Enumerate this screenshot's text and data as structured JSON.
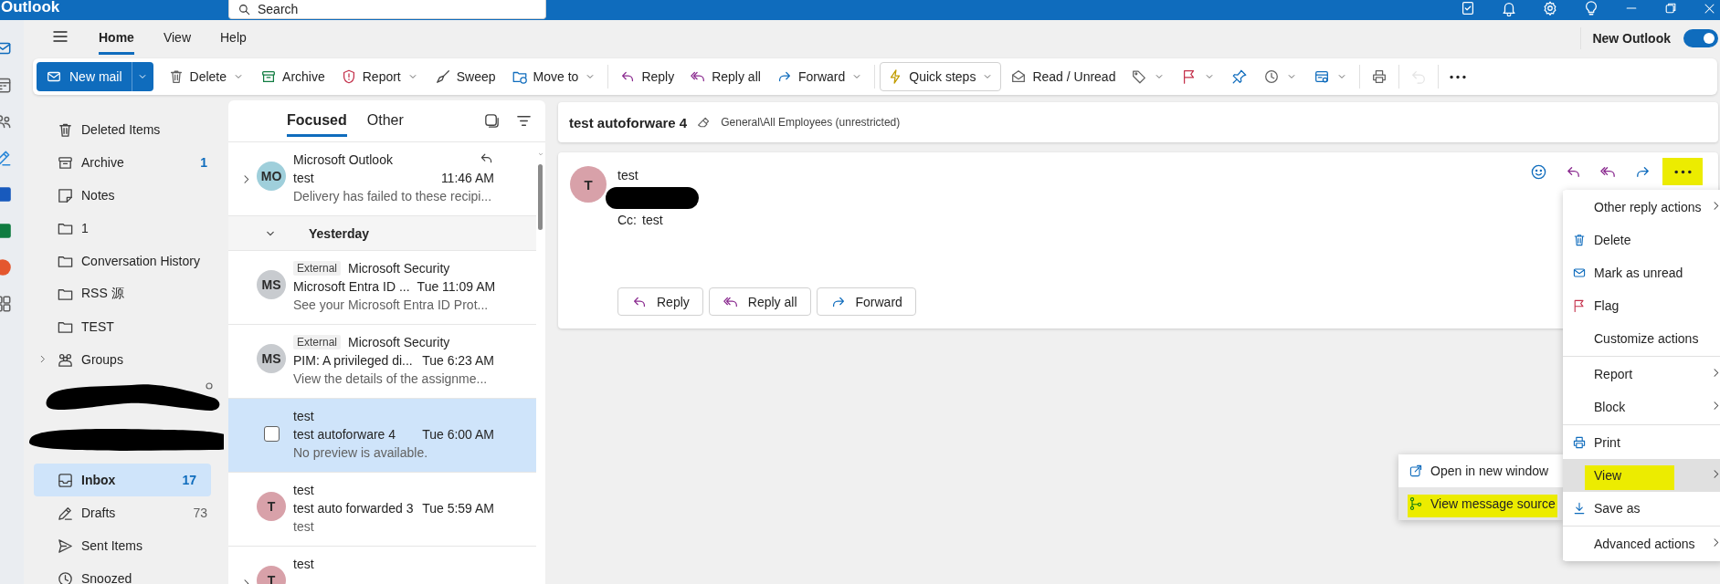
{
  "window": {
    "title": "Outlook"
  },
  "search": {
    "placeholder": "Search"
  },
  "tabs": [
    {
      "label": "Home",
      "selected": true
    },
    {
      "label": "View",
      "selected": false
    },
    {
      "label": "Help",
      "selected": false
    }
  ],
  "new_outlook": {
    "label": "New Outlook",
    "on": true
  },
  "ribbon": [
    {
      "kind": "primary",
      "label": "New mail",
      "has_menu": true,
      "disabled": false
    },
    {
      "kind": "button",
      "label": "Delete",
      "has_menu": true,
      "disabled": false
    },
    {
      "kind": "button",
      "label": "Archive",
      "has_menu": false,
      "disabled": false
    },
    {
      "kind": "button",
      "label": "Report",
      "has_menu": true,
      "disabled": false
    },
    {
      "kind": "button",
      "label": "Sweep",
      "has_menu": false,
      "disabled": false
    },
    {
      "kind": "button",
      "label": "Move to",
      "has_menu": true,
      "disabled": false
    },
    {
      "kind": "separator"
    },
    {
      "kind": "button",
      "label": "Reply",
      "has_menu": false,
      "disabled": false
    },
    {
      "kind": "button",
      "label": "Reply all",
      "has_menu": false,
      "disabled": false
    },
    {
      "kind": "button",
      "label": "Forward",
      "has_menu": true,
      "disabled": false
    },
    {
      "kind": "separator"
    },
    {
      "kind": "outlined",
      "label": "Quick steps",
      "has_menu": true,
      "disabled": false
    },
    {
      "kind": "button",
      "label": "Read / Unread",
      "has_menu": false,
      "disabled": false
    },
    {
      "kind": "icon",
      "has_menu": true,
      "disabled": false
    },
    {
      "kind": "icon",
      "has_menu": true,
      "disabled": false
    },
    {
      "kind": "icon",
      "has_menu": false,
      "disabled": false
    },
    {
      "kind": "icon",
      "has_menu": true,
      "disabled": false
    },
    {
      "kind": "icon",
      "has_menu": true,
      "disabled": false
    },
    {
      "kind": "separator"
    },
    {
      "kind": "icon",
      "has_menu": false,
      "disabled": false
    },
    {
      "kind": "separator"
    },
    {
      "kind": "icon",
      "has_menu": false,
      "disabled": true
    },
    {
      "kind": "separator"
    },
    {
      "kind": "icon",
      "has_menu": false,
      "disabled": false
    }
  ],
  "folders": [
    {
      "kind": "folder",
      "label": "Deleted Items",
      "selected": false
    },
    {
      "kind": "folder",
      "label": "Archive",
      "count": "1",
      "count_unread": true,
      "selected": false
    },
    {
      "kind": "folder",
      "label": "Notes",
      "selected": false
    },
    {
      "kind": "folder",
      "label": "1",
      "selected": false
    },
    {
      "kind": "folder",
      "label": "Conversation History",
      "selected": false
    },
    {
      "kind": "folder",
      "label": "RSS 源",
      "selected": false
    },
    {
      "kind": "folder",
      "label": "TEST",
      "selected": false
    },
    {
      "kind": "folder",
      "label": "Groups",
      "expanded": false,
      "selected": false
    },
    {
      "kind": "redacted"
    },
    {
      "kind": "folder",
      "label": "Inbox",
      "count": "17",
      "count_unread": true,
      "selected": true
    },
    {
      "kind": "folder",
      "label": "Drafts",
      "count": "73",
      "count_unread": false,
      "selected": false
    },
    {
      "kind": "folder",
      "label": "Sent Items",
      "selected": false
    },
    {
      "kind": "folder",
      "label": "Snoozed",
      "selected": false
    }
  ],
  "message_list": {
    "tabs": [
      {
        "label": "Focused",
        "selected": true
      },
      {
        "label": "Other",
        "selected": false
      }
    ],
    "items": [
      {
        "kind": "message",
        "sender": "Microsoft Outlook",
        "subject": "test",
        "time": "11:46 AM",
        "preview": "Delivery has failed to these recipi...",
        "initials": "MO",
        "color": "#9fcfdb",
        "thread": true,
        "status_icon": true,
        "selected": false
      },
      {
        "kind": "group",
        "label": "Yesterday",
        "expanded": true
      },
      {
        "kind": "message",
        "tag": "External",
        "sender": "Microsoft Security",
        "subject": "Microsoft Entra ID ...",
        "time": "Tue 11:09 AM",
        "preview": "See your Microsoft Entra ID Prot...",
        "initials": "MS",
        "color": "#c8cbcf",
        "thread": false,
        "status_icon": false,
        "selected": false
      },
      {
        "kind": "message",
        "tag": "External",
        "sender": "Microsoft Security",
        "subject": "PIM: A privileged di...",
        "time": "Tue 6:23 AM",
        "preview": "View the details of the assignme...",
        "initials": "MS",
        "color": "#c8cbcf",
        "thread": false,
        "status_icon": false,
        "selected": false
      },
      {
        "kind": "message",
        "sender": "test",
        "subject": "test autoforware 4",
        "time": "Tue 6:00 AM",
        "preview": "No preview is available.",
        "thread": false,
        "status_icon": false,
        "selected": true,
        "checked": false
      },
      {
        "kind": "message",
        "sender": "test",
        "subject": "test auto forwarded 3",
        "time": "Tue 5:59 AM",
        "preview": "test",
        "initials": "T",
        "color": "#d8a1a9",
        "thread": false,
        "status_icon": false,
        "selected": false
      },
      {
        "kind": "message",
        "sender": "test",
        "initials": "T",
        "color": "#d8a1a9",
        "thread": true,
        "status_icon": false,
        "selected": false
      }
    ]
  },
  "reading_pane": {
    "subject": "test autoforware 4",
    "label": "General\\All Employees (unrestricted)",
    "message": {
      "sender": "test",
      "initials": "T",
      "color": "#d8a1a9",
      "recipient_redacted": true,
      "cc_label": "Cc:",
      "cc": "test",
      "actions": [
        {
          "highlighted": false
        },
        {
          "highlighted": false
        },
        {
          "highlighted": false
        },
        {
          "highlighted": false
        },
        {
          "highlighted": true
        }
      ],
      "buttons": [
        {
          "label": "Reply"
        },
        {
          "label": "Reply all"
        },
        {
          "label": "Forward"
        }
      ]
    }
  },
  "context_menu": {
    "groups": [
      [
        {
          "label": "Other reply actions",
          "submenu": true,
          "selected": false,
          "highlighted": false
        },
        {
          "label": "Delete",
          "submenu": false,
          "selected": false,
          "highlighted": false
        },
        {
          "label": "Mark as unread",
          "submenu": false,
          "selected": false,
          "highlighted": false
        },
        {
          "label": "Flag",
          "submenu": false,
          "selected": false,
          "highlighted": false
        },
        {
          "label": "Customize actions",
          "submenu": false,
          "selected": false,
          "highlighted": false
        }
      ],
      [
        {
          "label": "Report",
          "submenu": true,
          "selected": false,
          "highlighted": false
        },
        {
          "label": "Block",
          "submenu": true,
          "selected": false,
          "highlighted": false
        }
      ],
      [
        {
          "label": "Print",
          "submenu": false,
          "selected": false,
          "highlighted": false
        },
        {
          "label": "View",
          "submenu": true,
          "selected": true,
          "highlighted": true
        },
        {
          "label": "Save as",
          "submenu": false,
          "selected": false,
          "highlighted": false
        }
      ],
      [
        {
          "label": "Advanced actions",
          "submenu": true,
          "selected": false,
          "highlighted": false
        }
      ]
    ]
  },
  "submenu": {
    "items": [
      {
        "label": "Open in new window",
        "selected": false,
        "highlighted": false
      },
      {
        "label": "View message source",
        "selected": true,
        "highlighted": true
      }
    ]
  }
}
